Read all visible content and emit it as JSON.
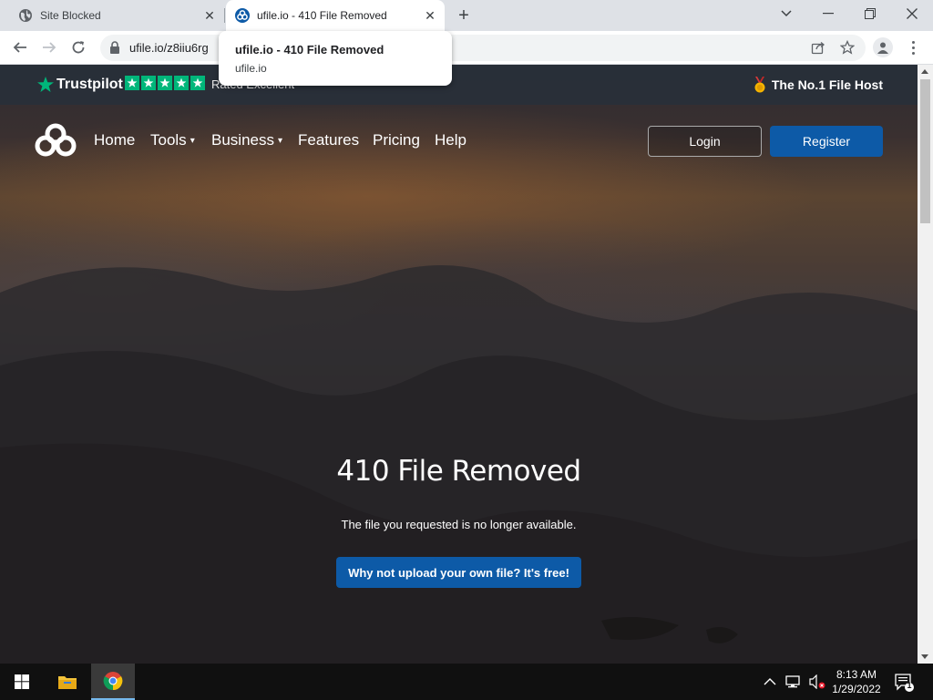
{
  "browser": {
    "tabs": [
      {
        "title": "Site Blocked",
        "active": false
      },
      {
        "title": "ufile.io - 410 File Removed",
        "active": true
      }
    ],
    "url": "ufile.io/z8iiu6rg",
    "hover_card": {
      "title": "ufile.io - 410 File Removed",
      "domain": "ufile.io"
    }
  },
  "site": {
    "trustbar": {
      "brand": "Trustpilot",
      "rating_text": "Rated Excellent",
      "rating_stars": 5,
      "badge_text": "The No.1 File Host"
    },
    "nav": {
      "items": [
        {
          "label": "Home",
          "dropdown": false
        },
        {
          "label": "Tools",
          "dropdown": true
        },
        {
          "label": "Business",
          "dropdown": true
        },
        {
          "label": "Features",
          "dropdown": false
        },
        {
          "label": "Pricing",
          "dropdown": false
        },
        {
          "label": "Help",
          "dropdown": false
        }
      ],
      "login_label": "Login",
      "register_label": "Register"
    },
    "hero": {
      "title": "410 File Removed",
      "subtitle": "The file you requested is no longer available.",
      "cta_label": "Why not upload your own file? It's free!"
    }
  },
  "taskbar": {
    "time": "8:13 AM",
    "date": "1/29/2022",
    "notification_count": "1"
  },
  "colors": {
    "accent_blue": "#0d5aa7",
    "trustpilot_green": "#00b67a",
    "trustbar_bg": "#28303a"
  }
}
